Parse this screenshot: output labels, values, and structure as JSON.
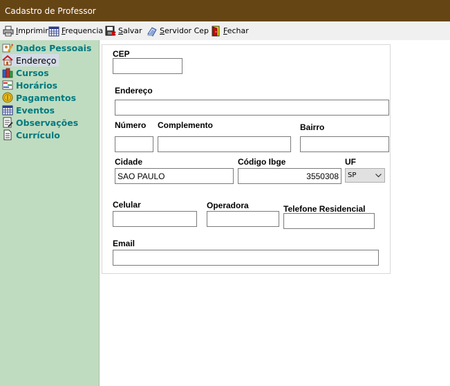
{
  "window": {
    "title": "Cadastro de Professor"
  },
  "toolbar": {
    "imprimir": {
      "pre": "",
      "key": "I",
      "rest": "mprimir"
    },
    "frequencia": {
      "pre": "",
      "key": "F",
      "rest": "requencia"
    },
    "salvar": {
      "pre": "",
      "key": "S",
      "rest": "alvar"
    },
    "servidor_cep": {
      "pre": "",
      "key": "S",
      "rest": "ervidor Cep"
    },
    "fechar": {
      "pre": "",
      "key": "F",
      "rest": "echar"
    }
  },
  "sidebar": {
    "items": [
      {
        "label": "Dados Pessoais",
        "icon": "user-edit-icon"
      },
      {
        "label": "Endereço",
        "icon": "house-icon"
      },
      {
        "label": "Cursos",
        "icon": "books-icon"
      },
      {
        "label": "Horários",
        "icon": "schedule-icon"
      },
      {
        "label": "Pagamentos",
        "icon": "coin-icon"
      },
      {
        "label": "Eventos",
        "icon": "calendar-icon"
      },
      {
        "label": "Observações",
        "icon": "notes-icon"
      },
      {
        "label": "Currículo",
        "icon": "document-icon"
      }
    ],
    "active_index": 1
  },
  "form": {
    "cep": {
      "label": "CEP",
      "value": ""
    },
    "endereco": {
      "label": "Endereço",
      "value": ""
    },
    "numero": {
      "label": "Número",
      "value": ""
    },
    "complemento": {
      "label": "Complemento",
      "value": ""
    },
    "bairro": {
      "label": "Bairro",
      "value": ""
    },
    "cidade": {
      "label": "Cidade",
      "value": "SAO PAULO"
    },
    "codigo_ibge": {
      "label": "Código Ibge",
      "value": "3550308"
    },
    "uf": {
      "label": "UF",
      "value": "SP"
    },
    "celular": {
      "label": "Celular",
      "value": ""
    },
    "operadora": {
      "label": "Operadora",
      "value": ""
    },
    "telefone_residencial": {
      "label": "Telefone Residencial",
      "value": ""
    },
    "email": {
      "label": "Email",
      "value": ""
    }
  }
}
